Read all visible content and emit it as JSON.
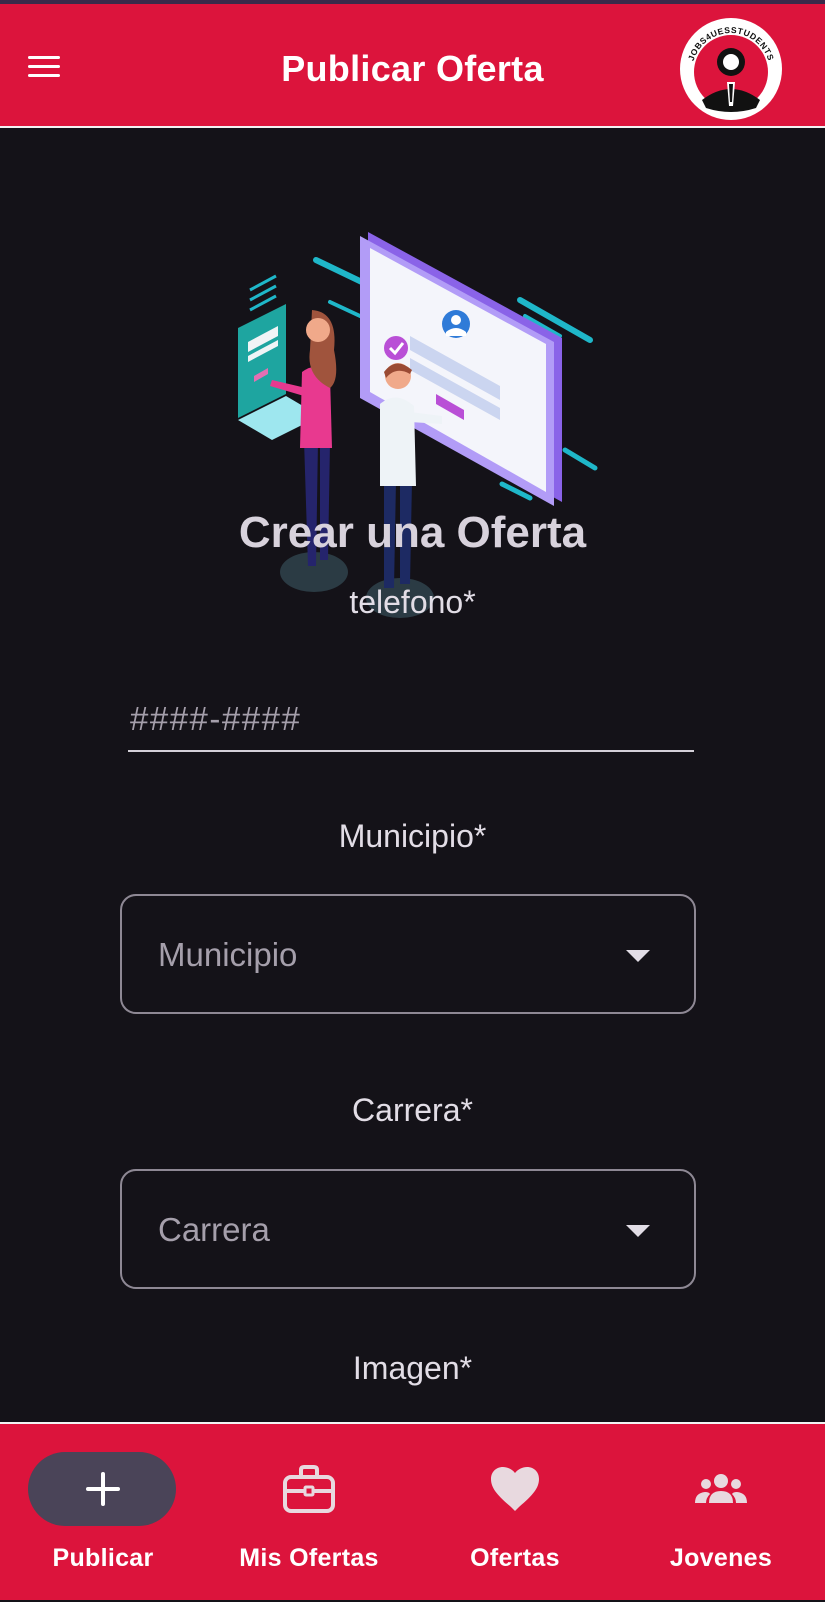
{
  "app_bar": {
    "title": "Publicar Oferta",
    "logo_text": "JOBS4UESSTUDENTS",
    "color": "#dc143c"
  },
  "form": {
    "heading": "Crear una Oferta",
    "telefono": {
      "label": "telefono*",
      "placeholder": "####-####",
      "value": ""
    },
    "municipio": {
      "label": "Municipio*",
      "selected": "Municipio"
    },
    "carrera": {
      "label": "Carrera*",
      "selected": "Carrera"
    },
    "imagen": {
      "label": "Imagen*"
    }
  },
  "bottom_nav": {
    "items": [
      {
        "label": "Publicar",
        "icon": "plus-icon",
        "active": true
      },
      {
        "label": "Mis Ofertas",
        "icon": "briefcase-icon",
        "active": false
      },
      {
        "label": "Ofertas",
        "icon": "heart-icon",
        "active": false
      },
      {
        "label": "Jovenes",
        "icon": "group-icon",
        "active": false
      }
    ]
  },
  "colors": {
    "accent": "#dc143c",
    "background": "#141218",
    "active_pill": "#4a4458"
  }
}
